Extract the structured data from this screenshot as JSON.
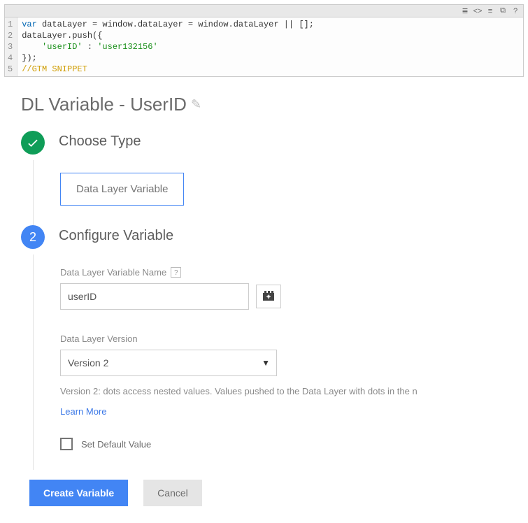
{
  "code": {
    "lines": [
      "1",
      "2",
      "3",
      "4",
      "5"
    ],
    "l1_kw": "var",
    "l1_a": " dataLayer ",
    "l1_eq": "=",
    "l1_b": " window",
    "l1_dot": ".",
    "l1_c": "dataLayer ",
    "l1_d": " window",
    "l1_e": "dataLayer ",
    "l1_or": "||",
    "l1_end": " [];",
    "l2": "dataLayer.push({",
    "l3_indent": "    ",
    "l3_k": "'userID'",
    "l3_sep": " : ",
    "l3_v": "'user132156'",
    "l4": "});",
    "l5": "//GTM SNIPPET"
  },
  "title": "DL Variable - UserID",
  "step1": {
    "heading": "Choose Type",
    "chip": "Data Layer Variable"
  },
  "step2": {
    "badge": "2",
    "heading": "Configure Variable",
    "name_label": "Data Layer Variable Name",
    "name_value": "userID",
    "version_label": "Data Layer Version",
    "version_value": "Version 2",
    "hint": "Version 2: dots access nested values. Values pushed to the Data Layer with dots in the n",
    "learn_more": "Learn More",
    "set_default": "Set Default Value"
  },
  "actions": {
    "create": "Create Variable",
    "cancel": "Cancel"
  }
}
